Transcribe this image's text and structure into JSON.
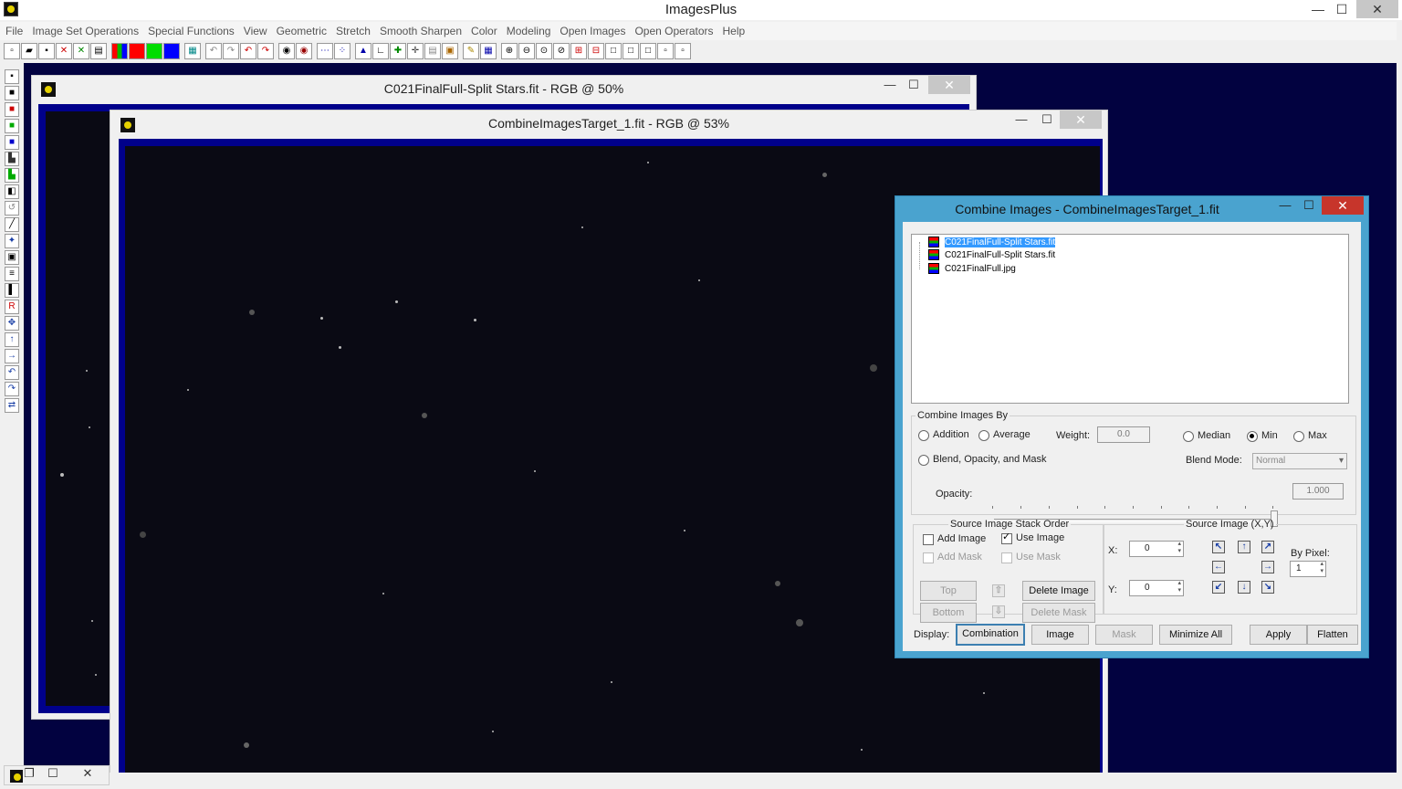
{
  "app": {
    "title": "ImagesPlus",
    "minimize": "—",
    "maximize": "☐",
    "close": "✕"
  },
  "menu": [
    "File",
    "Image Set Operations",
    "Special Functions",
    "View",
    "Geometric",
    "Stretch",
    "Smooth Sharpen",
    "Color",
    "Modeling",
    "Open Images",
    "Open Operators",
    "Help"
  ],
  "windows": {
    "back": {
      "title": "C021FinalFull-Split Stars.fit - RGB @ 50%"
    },
    "front": {
      "title": "CombineImagesTarget_1.fit - RGB @ 53%"
    }
  },
  "dialog": {
    "title": "Combine Images - CombineImagesTarget_1.fit",
    "images": [
      {
        "name": "C021FinalFull-Split Stars.fit",
        "selected": true
      },
      {
        "name": "C021FinalFull-Split Stars.fit",
        "selected": false
      },
      {
        "name": "C021FinalFull.jpg",
        "selected": false
      }
    ],
    "combine_group": {
      "legend": "Combine Images By",
      "addition": "Addition",
      "average": "Average",
      "weight_label": "Weight:",
      "weight_value": "0.0",
      "median": "Median",
      "min": "Min",
      "max": "Max",
      "selected_mode": "Min",
      "blend": "Blend, Opacity, and Mask",
      "blend_mode_label": "Blend Mode:",
      "blend_mode_value": "Normal",
      "opacity_label": "Opacity:",
      "opacity_value": "1.000",
      "opacity_level": 1.0
    },
    "stack_group": {
      "legend": "Source Image Stack Order",
      "add_image": "Add Image",
      "use_image": "Use Image",
      "add_mask": "Add Mask",
      "use_mask": "Use Mask",
      "top": "Top",
      "bottom": "Bottom",
      "delete_image": "Delete Image",
      "delete_mask": "Delete Mask"
    },
    "source_group": {
      "legend": "Source Image (X,Y)",
      "x_label": "X:",
      "x_value": "0",
      "y_label": "Y:",
      "y_value": "0",
      "by_pixel_label": "By Pixel:",
      "by_pixel_value": "1"
    },
    "bottom": {
      "display_label": "Display:",
      "combination": "Combination",
      "image": "Image",
      "mask": "Mask",
      "minimize_all": "Minimize All",
      "apply": "Apply",
      "flatten": "Flatten"
    }
  },
  "colors": {
    "mdi_background": "#020240",
    "image_frame": "#00008b",
    "dialog_frame": "#4aa3cf",
    "selection": "#3399ff"
  }
}
